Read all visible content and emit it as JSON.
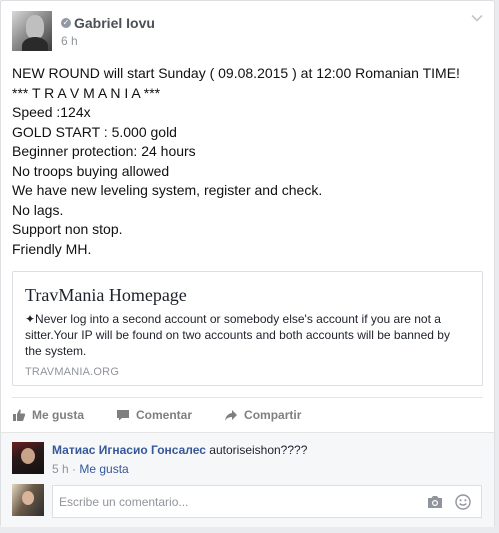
{
  "post": {
    "author": "Gabriel Iovu",
    "time": "6 h",
    "lines": [
      "NEW ROUND will start Sunday ( 09.08.2015 ) at 12:00 Romanian TIME!",
      "*** T R A V M A N I A ***",
      "Speed :124x",
      "GOLD START : 5.000 gold",
      "Beginner protection: 24 hours",
      "No troops buying allowed",
      "We have new leveling system, register and check.",
      "No lags.",
      "Support non stop.",
      "Friendly MH."
    ]
  },
  "link_preview": {
    "title": "TravMania Homepage",
    "description": "✦Never log into a second account or somebody else's account if you are not a sitter.Your IP will be found on two accounts and both accounts will be banned by the system.",
    "domain": "TRAVMANIA.ORG"
  },
  "actions": {
    "like": "Me gusta",
    "comment": "Comentar",
    "share": "Compartir"
  },
  "comment": {
    "author": "Матиас Игнасио Гонсалес",
    "text": "autoriseishon????",
    "time": "5 h",
    "separator": "·",
    "like": "Me gusta"
  },
  "composer": {
    "placeholder": "Escribe un comentario..."
  },
  "icons": {
    "verified": "verified-icon",
    "menu": "chevron-down-icon",
    "like": "thumbs-up-icon",
    "comment": "speech-bubble-icon",
    "share": "share-arrow-icon",
    "camera": "camera-icon",
    "emoji": "smiley-icon"
  },
  "colors": {
    "link_blue": "#365899",
    "muted": "#90949c",
    "action_gray": "#7f7f7f"
  }
}
